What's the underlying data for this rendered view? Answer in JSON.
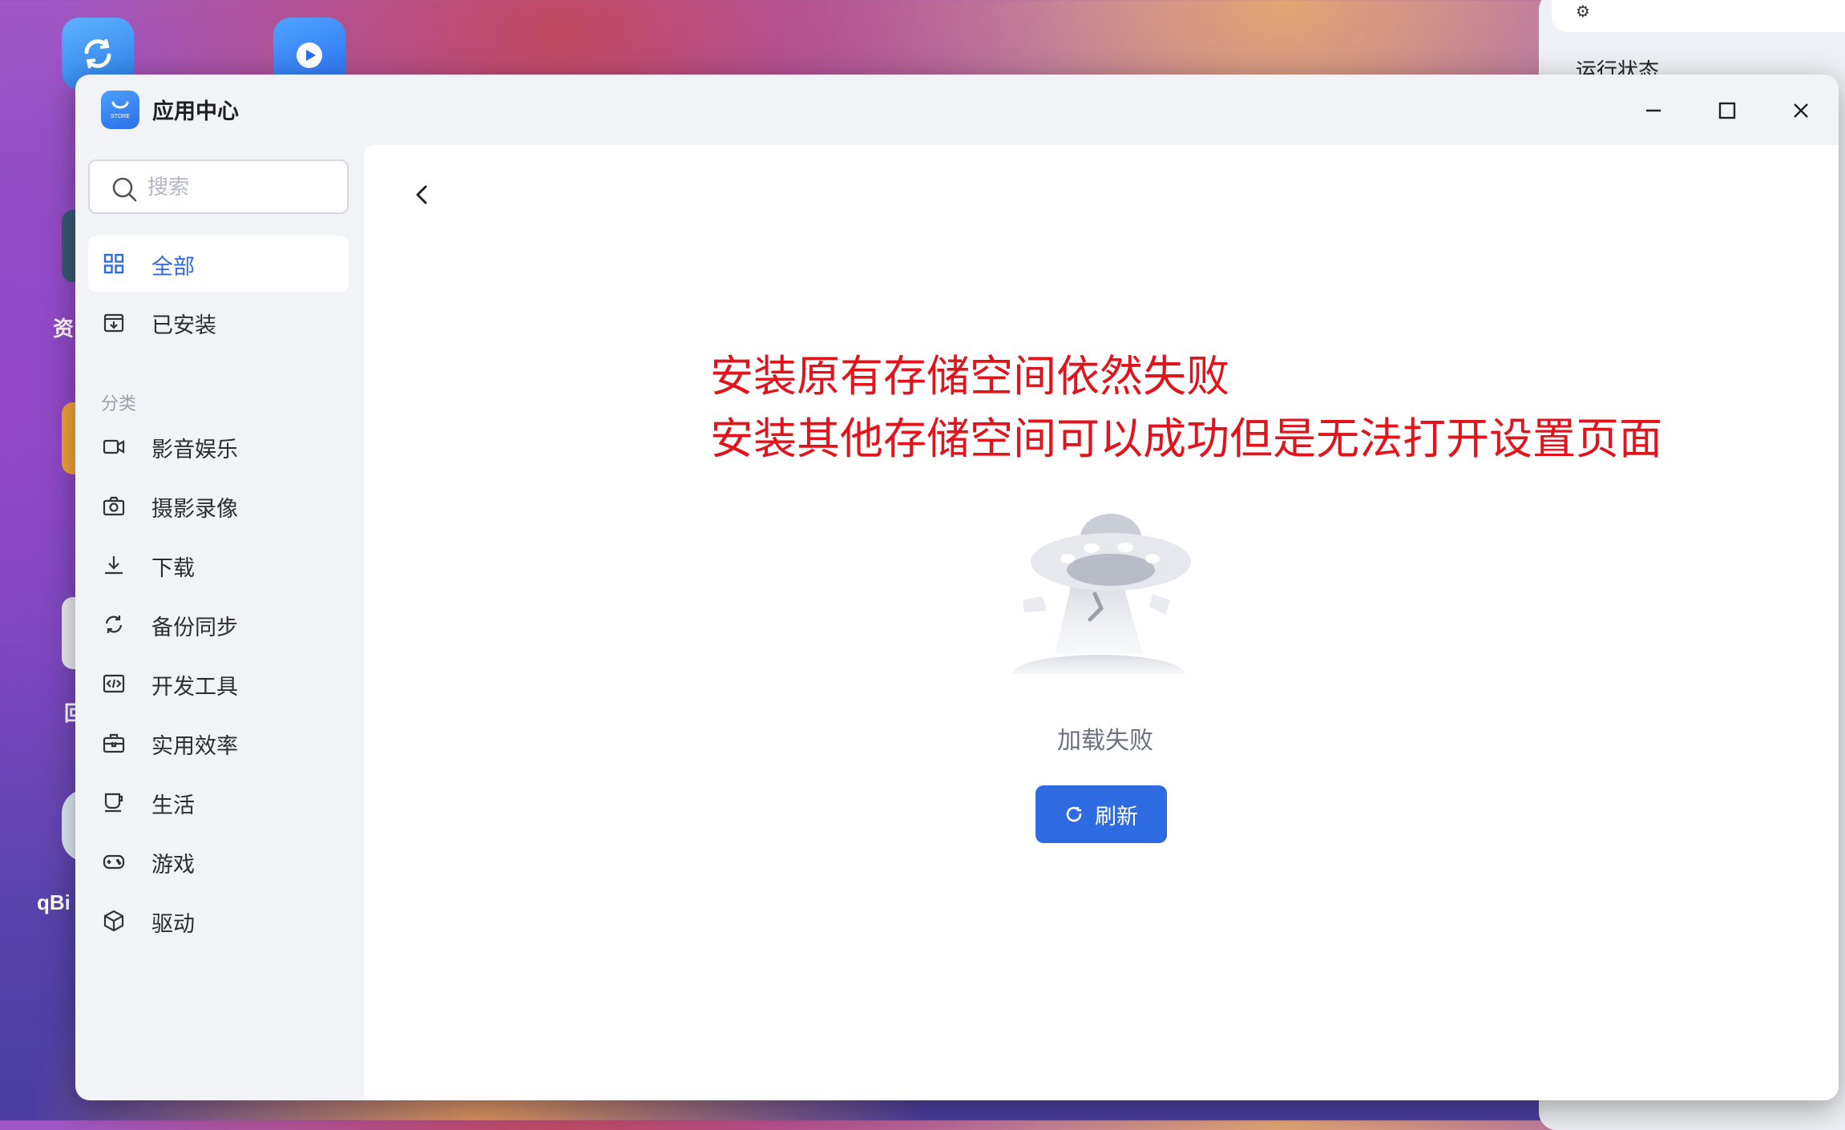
{
  "desktop": {
    "labels": [
      "资",
      "回",
      "qBi"
    ]
  },
  "background_panel": {
    "status_label": "运行状态"
  },
  "window": {
    "title": "应用中心",
    "logo_text": "STORE"
  },
  "sidebar": {
    "search_placeholder": "搜索",
    "top_items": [
      {
        "label": "全部",
        "icon": "grid-icon",
        "active": true
      },
      {
        "label": "已安装",
        "icon": "installed-icon",
        "active": false
      }
    ],
    "section_label": "分类",
    "categories": [
      {
        "label": "影音娱乐",
        "icon": "video-icon"
      },
      {
        "label": "摄影录像",
        "icon": "camera-icon"
      },
      {
        "label": "下载",
        "icon": "download-icon"
      },
      {
        "label": "备份同步",
        "icon": "sync-icon"
      },
      {
        "label": "开发工具",
        "icon": "code-icon"
      },
      {
        "label": "实用效率",
        "icon": "toolbox-icon"
      },
      {
        "label": "生活",
        "icon": "cup-icon"
      },
      {
        "label": "游戏",
        "icon": "gamepad-icon"
      },
      {
        "label": "驱动",
        "icon": "cube-icon"
      }
    ]
  },
  "main": {
    "annotation_line1": "安装原有存储空间依然失败",
    "annotation_line2": "安装其他存储空间可以成功但是无法打开设置页面",
    "error_text": "加载失败",
    "refresh_label": "刷新",
    "colors": {
      "accent": "#2e6be0",
      "annotation": "#e1141c"
    }
  }
}
